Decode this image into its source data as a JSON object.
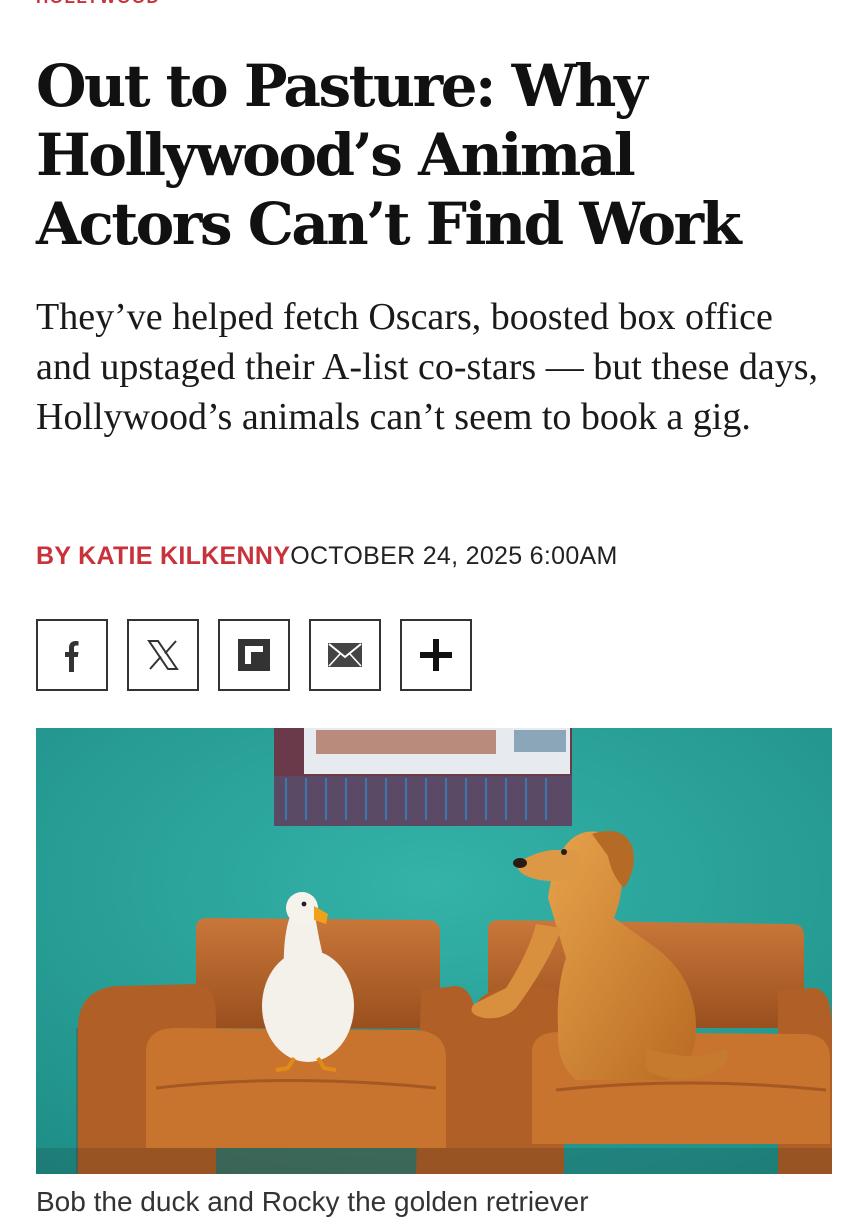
{
  "article": {
    "section": "Hollywood",
    "headline": "Out to Pasture: Why Hollywood’s Animal Actors Can’t Find Work",
    "dek": "They’ve helped fetch Oscars, boosted box office and upstaged their A-list co-stars — but these days, Hollywood’s animals can’t seem to book a gig.",
    "byline": "BY KATIE KILKENNY",
    "date": "OCTOBER 24, 2025 6:00AM",
    "caption": "Bob the duck and Rocky the golden retriever"
  },
  "share": [
    {
      "name": "facebook",
      "icon": "facebook-icon"
    },
    {
      "name": "x",
      "icon": "x-icon"
    },
    {
      "name": "flipboard",
      "icon": "flipboard-icon"
    },
    {
      "name": "email",
      "icon": "mail-icon"
    },
    {
      "name": "more",
      "icon": "plus-icon"
    }
  ],
  "colors": {
    "accent": "#c8323a",
    "wall": "#2aa39a",
    "leather": "#b8652a"
  }
}
